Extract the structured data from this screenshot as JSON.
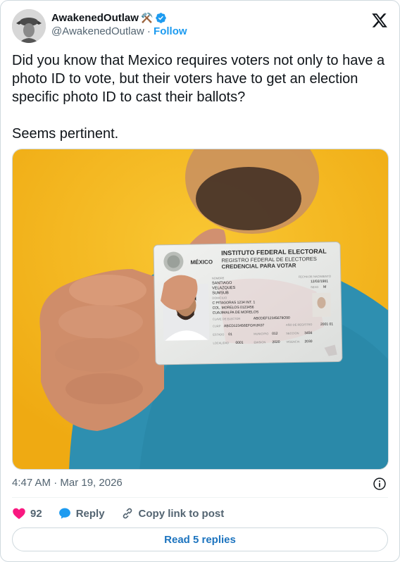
{
  "author": {
    "display_name": "AwakenedOutlaw",
    "emoji": "⚒️",
    "handle": "@AwakenedOutlaw",
    "separator": " · ",
    "follow_label": "Follow"
  },
  "tweet": {
    "text": "Did you know that Mexico requires voters not only to have a photo ID to vote, but their voters have to get an election specific photo ID to cast their ballots?\n\nSeems pertinent."
  },
  "id_card": {
    "institute": "INSTITUTO FEDERAL ELECTORAL",
    "country": "MÉXICO",
    "registry": "REGISTRO FEDERAL DE ELECTORES",
    "credential": "CREDENCIAL PARA VOTAR",
    "nombre_label": "NOMBRE",
    "name_lines": [
      "SANTIAGO",
      "VELAZQUES",
      "SUMSUB"
    ],
    "domicilio_label": "DOMICILIO",
    "address_lines": [
      "C PITAGORAS 1234 INT. 1",
      "COL. MORELOS 0123456",
      "CUAJIMALPA DE MORELOS"
    ],
    "clave_label": "CLAVE DE ELECTOR",
    "clave_value": "ABCDEF12345678O90",
    "curp_label": "CURP",
    "curp_value": "ABCD123456EFGHIJK07",
    "anio_label": "AÑO DE REGISTRO",
    "anio_value": "2001 01",
    "estado_label": "ESTADO",
    "estado_value": "01",
    "municipio_label": "MUNICIPIO",
    "municipio_value": "012",
    "seccion_label": "SECCION",
    "seccion_value": "3456",
    "localidad_label": "LOCALIDAD",
    "localidad_value": "0001",
    "emision_label": "EMISION",
    "emision_value": "2020",
    "vigencia_label": "VIGENCIA",
    "vigencia_value": "2030",
    "fecha_label": "FECHA DE NACIMIENTO",
    "fecha_value": "12/02/1981",
    "sexo_label": "SEXO",
    "sexo_value": "M"
  },
  "meta": {
    "timestamp": "4:47 AM · Mar 19, 2026"
  },
  "actions": {
    "like_count": "92",
    "reply_label": "Reply",
    "copy_label": "Copy link to post"
  },
  "footer": {
    "read_replies": "Read 5 replies"
  },
  "colors": {
    "accent": "#1d9bf0",
    "like": "#f91880",
    "text": "#0f1419",
    "muted": "#536471",
    "photo_background": "#f4b81f",
    "shirt": "#2e8fb0"
  }
}
